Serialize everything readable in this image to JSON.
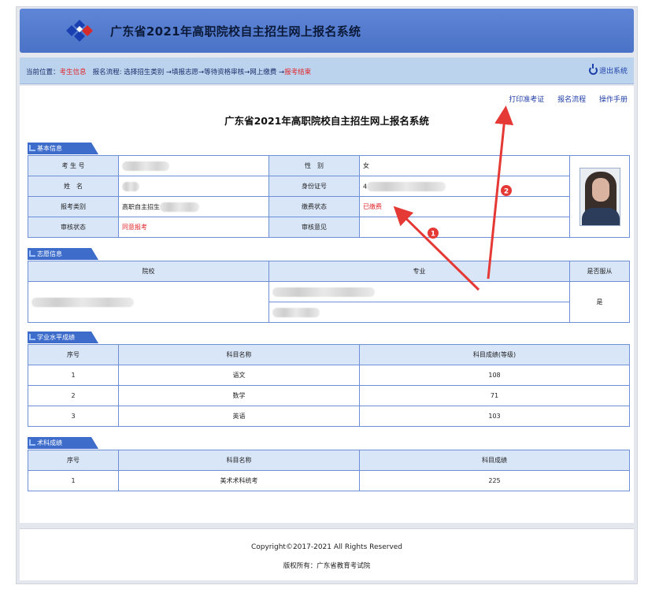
{
  "header": {
    "title": "广东省2021年高职院校自主招生网上报名系统"
  },
  "navbar": {
    "location_label": "当前位置：",
    "location_value": "考生信息",
    "flow_label": "报名流程: 选择招生类别 →填报志愿→等待资格审核→网上缴费 →",
    "flow_end": "报考结束",
    "logout": "退出系统"
  },
  "top_links": {
    "print": "打印准考证",
    "flow": "报名流程",
    "manual": "操作手册"
  },
  "page_title": "广东省2021年高职院校自主招生网上报名系统",
  "basic": {
    "tab": "基本信息",
    "exam_no_label": "考 生 号",
    "gender_label": "性　别",
    "gender_value": "女",
    "name_label": "姓　名",
    "id_label": "身份证号",
    "id_value_prefix": "4",
    "category_label": "报考类别",
    "category_value": "高职自主招生",
    "pay_label": "缴费状态",
    "pay_value": "已缴费",
    "audit_label": "审核状态",
    "audit_value": "同意报考",
    "opinion_label": "审核意见"
  },
  "volunteer": {
    "tab": "志愿信息",
    "col_school": "院校",
    "col_major": "专业",
    "col_obey": "是否服从",
    "obey_value": "是"
  },
  "academic": {
    "tab": "学业水平成绩",
    "headers": [
      "序号",
      "科目名称",
      "科目成绩(等级)"
    ],
    "rows": [
      {
        "no": "1",
        "subject": "语文",
        "score": "108"
      },
      {
        "no": "2",
        "subject": "数学",
        "score": "71"
      },
      {
        "no": "3",
        "subject": "英语",
        "score": "103"
      }
    ]
  },
  "technical": {
    "tab": "术科成绩",
    "headers": [
      "序号",
      "科目名称",
      "科目成绩"
    ],
    "rows": [
      {
        "no": "1",
        "subject": "美术术科统考",
        "score": "225"
      }
    ]
  },
  "footer": {
    "copyright": "Copyright©2017-2021  All  Rights  Reserved",
    "owner": "版权所有：广东省教育考试院"
  },
  "annotations": {
    "marker1": "1",
    "marker2": "2"
  },
  "colors": {
    "header": "#4a72c6",
    "accent_red": "#e0262a",
    "table_border": "#6e8fd8",
    "annotation": "#e53935"
  }
}
